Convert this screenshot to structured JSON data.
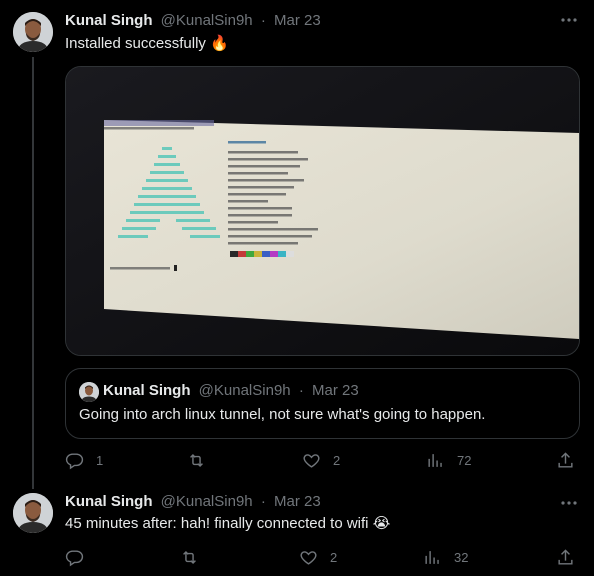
{
  "tweet1": {
    "author_name": "Kunal Singh",
    "handle": "@KunalSin9h",
    "separator": "·",
    "date": "Mar 23",
    "text": "Installed successfully",
    "emoji": "🔥",
    "more_icon": "more-horizontal-icon",
    "media": {
      "terminal_prompt": "[kunal@kunalsin9h ~]$ neofetch",
      "bottom_prompt": "[kunal@kunalsin9h ~]$",
      "palette": [
        "#2a2a2a",
        "#c43a3a",
        "#3fa83f",
        "#c9b43a",
        "#3a5fc4",
        "#b43ac4",
        "#3ab4c4",
        "#dddddd"
      ]
    },
    "quote": {
      "author_name": "Kunal Singh",
      "handle": "@KunalSin9h",
      "separator": "·",
      "date": "Mar 23",
      "text": "Going into arch linux tunnel, not sure what's going to happen."
    },
    "actions": {
      "replies": "1",
      "retweets": "",
      "likes": "2",
      "views": "72"
    }
  },
  "tweet2": {
    "author_name": "Kunal Singh",
    "handle": "@KunalSin9h",
    "separator": "·",
    "date": "Mar 23",
    "text": "45 minutes after: hah! finally connected to wifi",
    "emoji": "😭",
    "actions": {
      "replies": "",
      "retweets": "",
      "likes": "2",
      "views": "32"
    }
  },
  "colors": {
    "background": "#000000",
    "text": "#e7e9ea",
    "muted": "#71767b",
    "border": "#2f3336"
  }
}
